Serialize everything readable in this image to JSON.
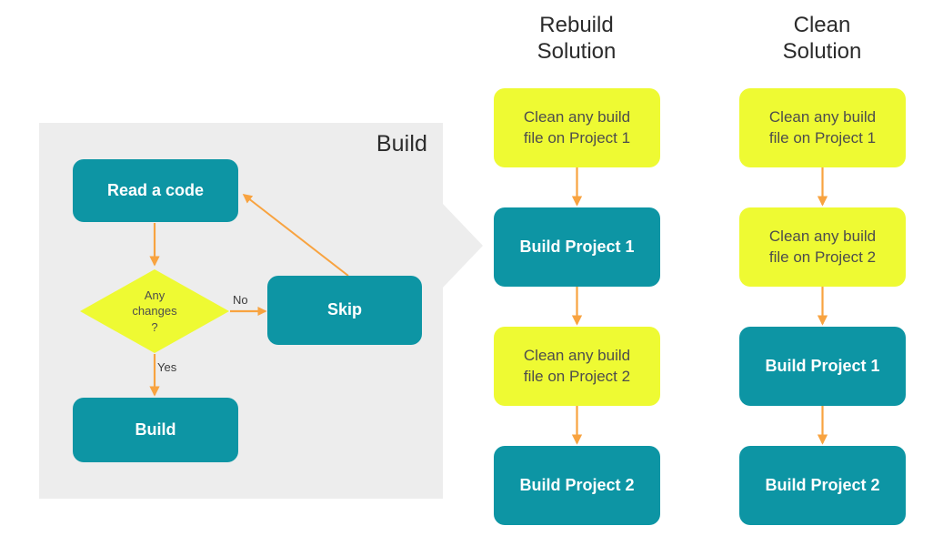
{
  "panel": {
    "title": "Build",
    "background_color": "#ededed"
  },
  "colors": {
    "teal": "#0d95a4",
    "yellow": "#eefa33",
    "orange": "#f8a340",
    "panel_grey": "#ededed",
    "dark_text": "#4d4d4d",
    "white_text": "#ffffff"
  },
  "flow": {
    "nodes": [
      {
        "id": "read-a-code",
        "label": "Read a code",
        "shape": "rounded-rect",
        "fill": "teal"
      },
      {
        "id": "any-changes",
        "label_lines": [
          "Any",
          "changes",
          "?"
        ],
        "shape": "diamond",
        "fill": "yellow"
      },
      {
        "id": "skip",
        "label": "Skip",
        "shape": "rounded-rect",
        "fill": "teal"
      },
      {
        "id": "build",
        "label": "Build",
        "shape": "rounded-rect",
        "fill": "teal"
      }
    ],
    "edges": [
      {
        "from": "read-a-code",
        "to": "any-changes",
        "label": ""
      },
      {
        "from": "any-changes",
        "to": "skip",
        "label": "No"
      },
      {
        "from": "any-changes",
        "to": "build",
        "label": "Yes"
      },
      {
        "from": "skip",
        "to": "read-a-code",
        "label": ""
      }
    ],
    "diamond": {
      "line1": "Any",
      "line2": "changes",
      "line3": "?"
    },
    "edge_labels": {
      "no": "No",
      "yes": "Yes"
    }
  },
  "columns": [
    {
      "id": "rebuild-solution",
      "heading_line1": "Rebuild",
      "heading_line2": "Solution",
      "steps": [
        {
          "label_line1": "Clean any build",
          "label_line2": "file on Project 1",
          "fill": "yellow"
        },
        {
          "label_line1": "Build Project 1",
          "label_line2": "",
          "fill": "teal"
        },
        {
          "label_line1": "Clean any build",
          "label_line2": "file on Project 2",
          "fill": "yellow"
        },
        {
          "label_line1": "Build Project 2",
          "label_line2": "",
          "fill": "teal"
        }
      ]
    },
    {
      "id": "clean-solution",
      "heading_line1": "Clean",
      "heading_line2": "Solution",
      "steps": [
        {
          "label_line1": "Clean any build",
          "label_line2": "file on Project 1",
          "fill": "yellow"
        },
        {
          "label_line1": "Clean any build",
          "label_line2": "file on Project 2",
          "fill": "yellow"
        },
        {
          "label_line1": "Build Project 1",
          "label_line2": "",
          "fill": "teal"
        },
        {
          "label_line1": "Build Project 2",
          "label_line2": "",
          "fill": "teal"
        }
      ]
    }
  ]
}
